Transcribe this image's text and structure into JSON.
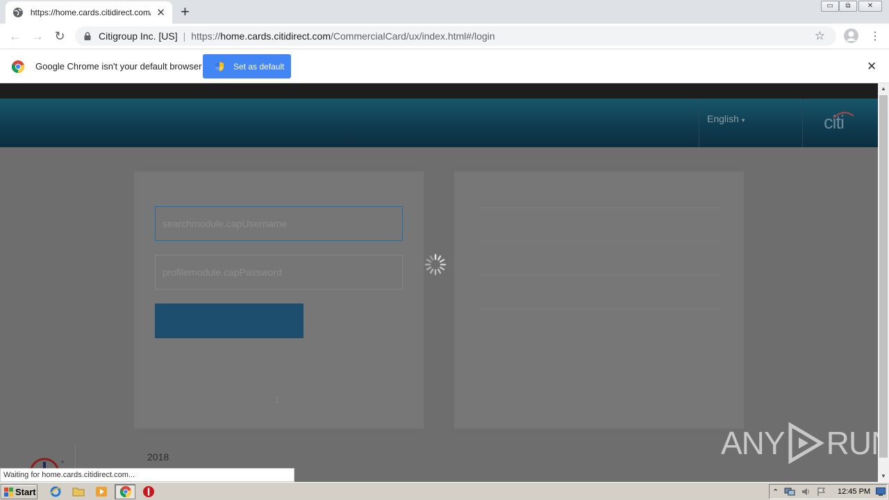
{
  "browser": {
    "tab_title": "https://home.cards.citidirect.com/Co",
    "tab_close": "✕",
    "new_tab": "+",
    "window_buttons": [
      "▭",
      "⧉",
      "✕"
    ],
    "org": "Citigroup Inc. [US]",
    "url_scheme": "https://",
    "url_host": "home.cards.citidirect.com",
    "url_path": "/CommercialCard/ux/index.html#/login",
    "back_icon": "←",
    "forward_icon": "→",
    "reload_icon": "↻",
    "star_icon": "☆",
    "menu_icon": "⋮"
  },
  "infobar": {
    "message": "Google Chrome isn't your default browser",
    "button_label": "Set as default",
    "close": "✕"
  },
  "page": {
    "language": "English",
    "language_caret": "▾",
    "brand": "citi",
    "username_placeholder": "searchmodule.capUsername",
    "password_placeholder": "profilemodule.capPassword",
    "small_mark": "1",
    "year": "2018",
    "watermark_left": "ANY",
    "watermark_right": "RUN"
  },
  "status_bar": "Waiting for home.cards.citidirect.com...",
  "scrollbar": {
    "up": "▲",
    "down": "▼"
  },
  "taskbar": {
    "start_label": "Start",
    "tray_up": "⌃",
    "clock": "12:45 PM"
  },
  "colors": {
    "accent_blue": "#4285f4",
    "header_teal": "#18576a",
    "overlay_gray": "#6e6e6e"
  }
}
